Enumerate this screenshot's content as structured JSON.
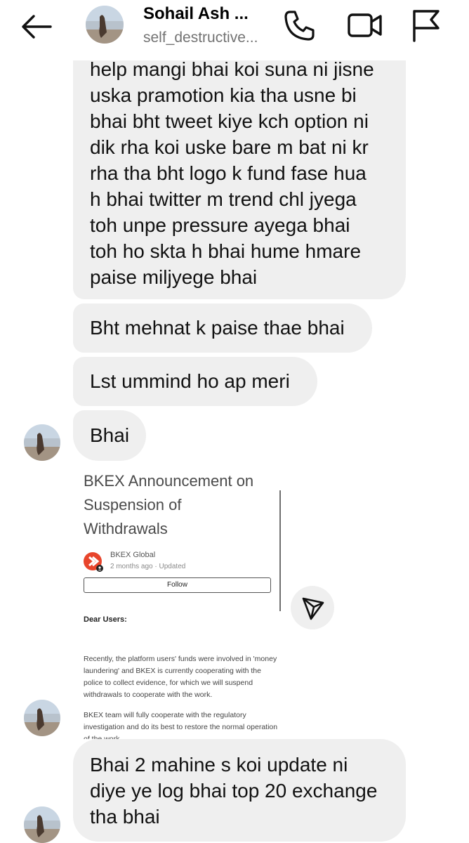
{
  "header": {
    "title": "Sohail Ash ...",
    "subtitle": "self_destructive..."
  },
  "messages": {
    "long_lines": [
      "help mangi bhai koi suna ni jisne",
      "uska pramotion kia tha usne bi",
      "bhai bht tweet kiye kch option ni",
      "dik rha koi uske bare m bat ni kr",
      "rha tha bht logo k fund fase hua",
      "h bhai twitter m trend chl jyega",
      "toh unpe pressure ayega bhai",
      "toh ho skta h bhai hume hmare",
      "paise miljyege bhai"
    ],
    "msg2": "Bht mehnat k paise thae bhai",
    "msg3": "Lst ummind ho ap meri",
    "msg4": "Bhai",
    "last_lines": [
      "Bhai 2 mahine s koi update ni",
      "diye ye log bhai top 20 exchange",
      "tha bhai"
    ]
  },
  "post": {
    "title_lines": [
      "BKEX Announcement on",
      "Suspension of",
      "Withdrawals"
    ],
    "org": "BKEX Global",
    "time": "2 months ago",
    "separator": "·",
    "updated": "Updated",
    "follow": "Follow",
    "greeting": "Dear Users:",
    "para1": "Recently, the platform users' funds were involved in 'money laundering' and BKEX is currently cooperating with the police to collect evidence, for which we will suspend withdrawals to cooperate with the work.",
    "para2": "BKEX team will fully cooperate with the regulatory investigation and do its best to restore the normal operation of the work."
  },
  "colors": {
    "bubble": "#efefef",
    "logo_red": "#e8452c",
    "subtitle_gray": "#737373"
  }
}
